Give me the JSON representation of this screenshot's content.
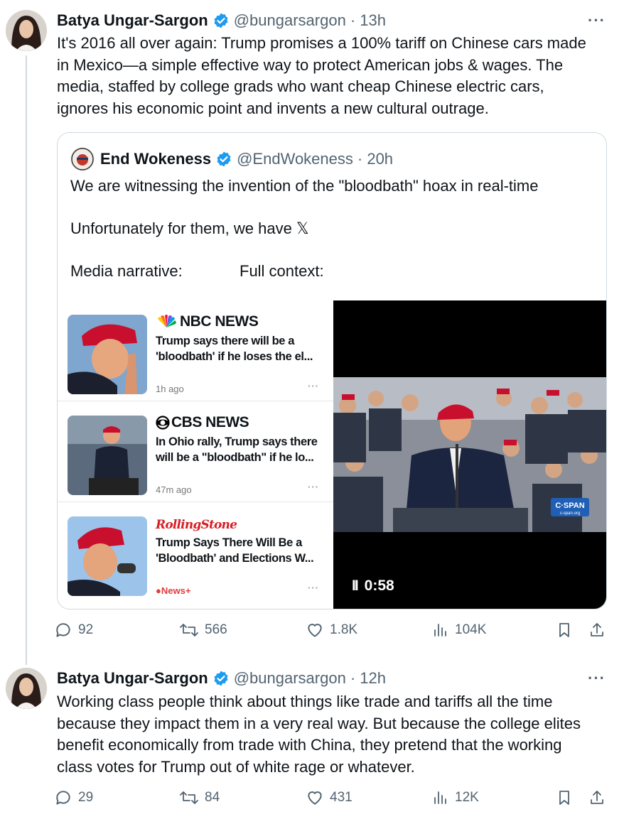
{
  "tweets": [
    {
      "author": {
        "name": "Batya Ungar-Sargon",
        "handle": "@bungarsargon",
        "time": "· 13h"
      },
      "more_icon": "···",
      "lines": [
        "It's 2016 all over again: Trump promises a 100% tariff on Chinese cars made",
        "in Mexico—a simple effective way to protect American jobs & wages. The",
        "media, staffed by college grads who want cheap Chinese electric cars,",
        "ignores his economic point and invents a new cultural outrage."
      ],
      "stats": {
        "replies": "92",
        "reposts": "566",
        "likes": "1.8K",
        "views": "104K"
      }
    },
    {
      "author": {
        "name": "Batya Ungar-Sargon",
        "handle": "@bungarsargon",
        "time": "· 12h"
      },
      "more_icon": "···",
      "lines": [
        "Working class people think about things like trade and tariffs all the time",
        "because they impact them in a very real way. But because the college elites",
        "benefit economically from trade with China, they pretend that the working",
        "class votes for Trump out of white rage or whatever."
      ],
      "stats": {
        "replies": "29",
        "reposts": "84",
        "likes": "431",
        "views": "12K"
      }
    }
  ],
  "quote": {
    "author": {
      "name": "End Wokeness",
      "handle": "@EndWokeness",
      "time": "· 20h"
    },
    "line1": "We are witnessing the invention of the \"bloodbath\" hoax in real-time",
    "line2": "Unfortunately for them, we have 𝕏",
    "label_left": "Media narrative:",
    "label_right": "Full context:",
    "news": [
      {
        "source": "NBC NEWS",
        "headline": [
          "Trump says there will be a",
          "'bloodbath' if he loses the el..."
        ],
        "ago": "1h ago",
        "dots": "···"
      },
      {
        "source": "CBS NEWS",
        "headline": [
          "In Ohio rally, Trump says there",
          "will be a \"bloodbath\" if he lo..."
        ],
        "ago": "47m ago",
        "dots": "···"
      },
      {
        "source": "RollingStone",
        "headline": [
          "Trump Says There Will Be a",
          "'Bloodbath' and Elections W..."
        ],
        "ago": "News+",
        "dots": "···"
      }
    ],
    "video": {
      "time": "0:58",
      "pause_icon": "II",
      "watermark": "C·SPAN",
      "watermark_sub": "c-span.org"
    }
  },
  "colors": {
    "verified": "#1d9bf0",
    "muted": "#536471",
    "border": "#cfd9de",
    "nbc_text": "#000000",
    "rolling_stone": "#d61f26",
    "cspan": "#1f5fb5"
  }
}
